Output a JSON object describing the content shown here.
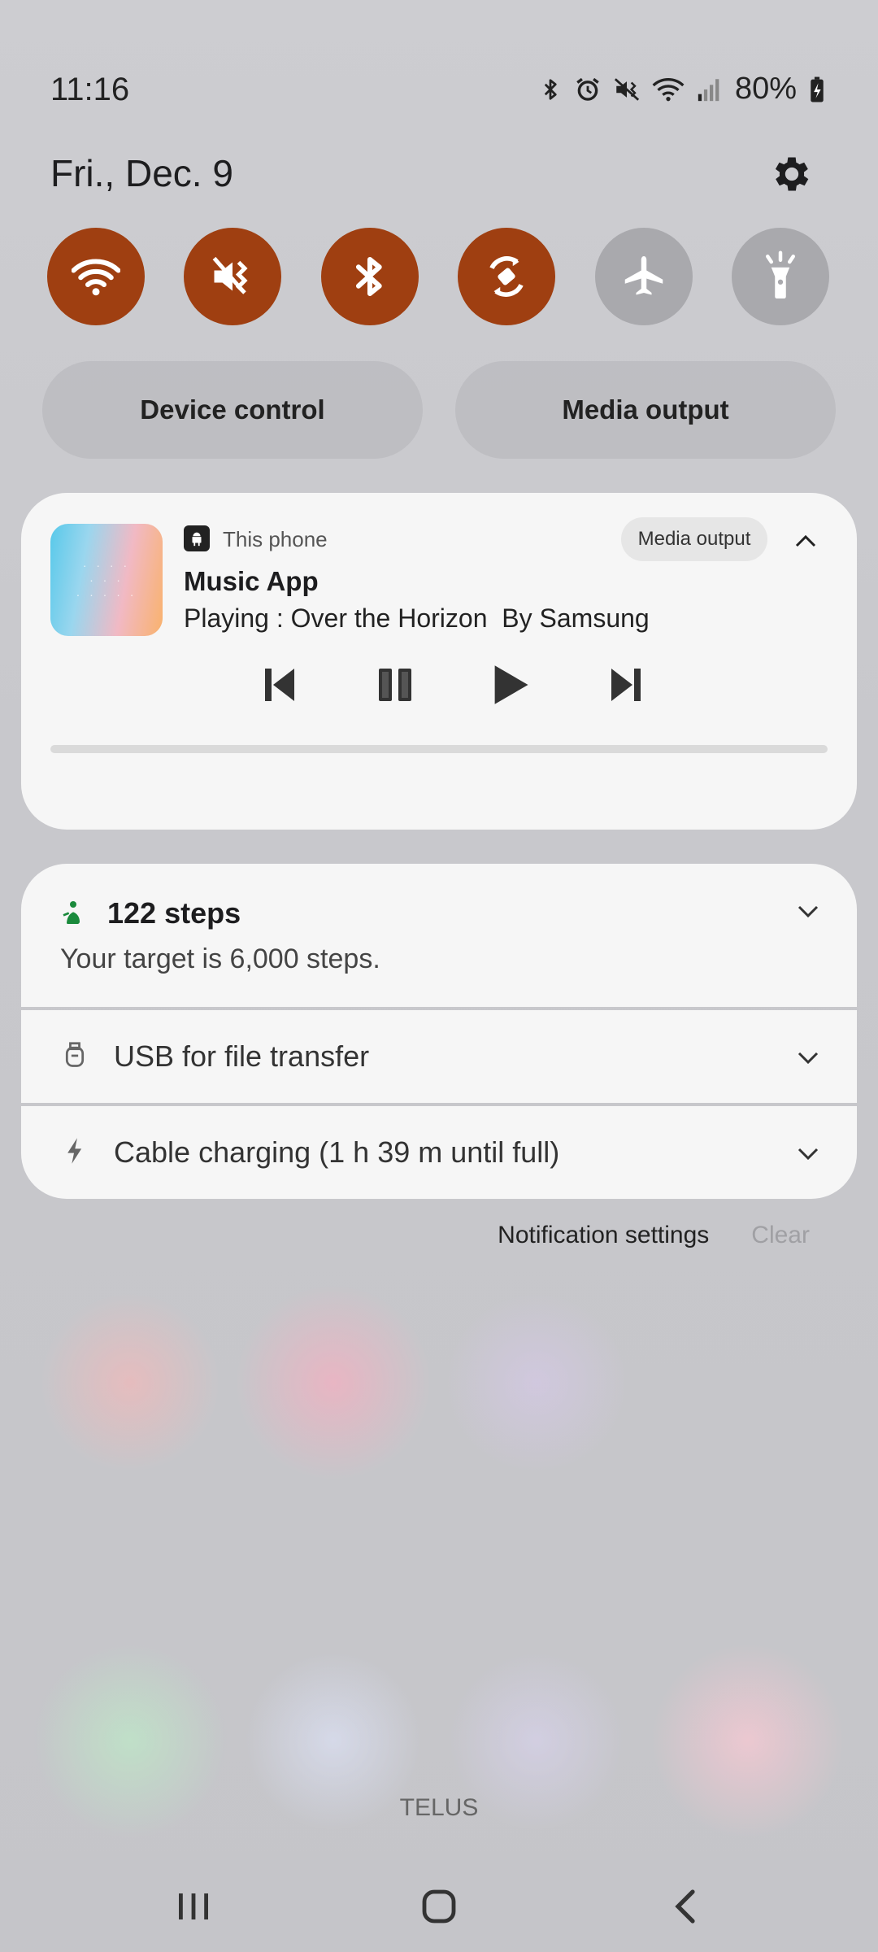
{
  "status_bar": {
    "time": "11:16",
    "battery_percent": "80%",
    "icons": [
      "bluetooth-icon",
      "alarm-icon",
      "mute-icon",
      "wifi-icon",
      "signal-icon",
      "battery-charging-icon"
    ]
  },
  "header": {
    "date": "Fri., Dec. 9",
    "settings_icon": "gear-icon"
  },
  "quick_toggles": [
    {
      "name": "wifi",
      "icon": "wifi-icon",
      "state": "on"
    },
    {
      "name": "sound",
      "icon": "mute-icon",
      "state": "on"
    },
    {
      "name": "bluetooth",
      "icon": "bluetooth-icon",
      "state": "on"
    },
    {
      "name": "auto-rotate",
      "icon": "rotate-icon",
      "state": "on"
    },
    {
      "name": "airplane-mode",
      "icon": "airplane-icon",
      "state": "off"
    },
    {
      "name": "flashlight",
      "icon": "flashlight-icon",
      "state": "off"
    }
  ],
  "colors": {
    "toggle_on": "#9f3f11",
    "toggle_off": "#a9a9ad",
    "steps_icon": "#1a8a3c"
  },
  "buttons": {
    "device_control": "Device control",
    "media_output": "Media output"
  },
  "media": {
    "source": "This phone",
    "output_chip": "Media output",
    "app_name": "Music App",
    "track_line": "Playing : Over the Horizon  By Samsung",
    "controls": [
      "previous-icon",
      "pause-icon",
      "play-icon",
      "next-icon"
    ],
    "progress": 0
  },
  "notifications": {
    "steps": {
      "title": "122 steps",
      "subtitle": "Your target is 6,000 steps."
    },
    "usb": {
      "title": "USB for file transfer"
    },
    "charging": {
      "title": "Cable charging (1 h 39 m until full)"
    }
  },
  "notif_actions": {
    "settings": "Notification settings",
    "clear": "Clear"
  },
  "carrier": "TELUS",
  "navbar": [
    "recents-icon",
    "home-icon",
    "back-icon"
  ]
}
